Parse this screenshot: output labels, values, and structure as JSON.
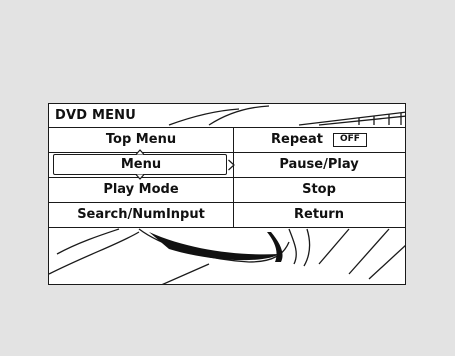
{
  "screen": {
    "title": "DVD MENU"
  },
  "menu": {
    "left": [
      {
        "label": "Top Menu"
      },
      {
        "label": "Menu",
        "selected": true
      },
      {
        "label": "Play Mode"
      },
      {
        "label": "Search/NumInput"
      }
    ],
    "right": [
      {
        "label": "Repeat",
        "badge": "OFF"
      },
      {
        "label": "Pause/Play"
      },
      {
        "label": "Stop"
      },
      {
        "label": "Return"
      }
    ]
  },
  "icons": {
    "arrow_up": "up-arrow-icon",
    "arrow_down": "down-arrow-icon",
    "arrow_right": "right-arrow-icon"
  },
  "colors": {
    "background": "#e3e3e3",
    "screen": "#ffffff",
    "line": "#1a1a1a"
  }
}
